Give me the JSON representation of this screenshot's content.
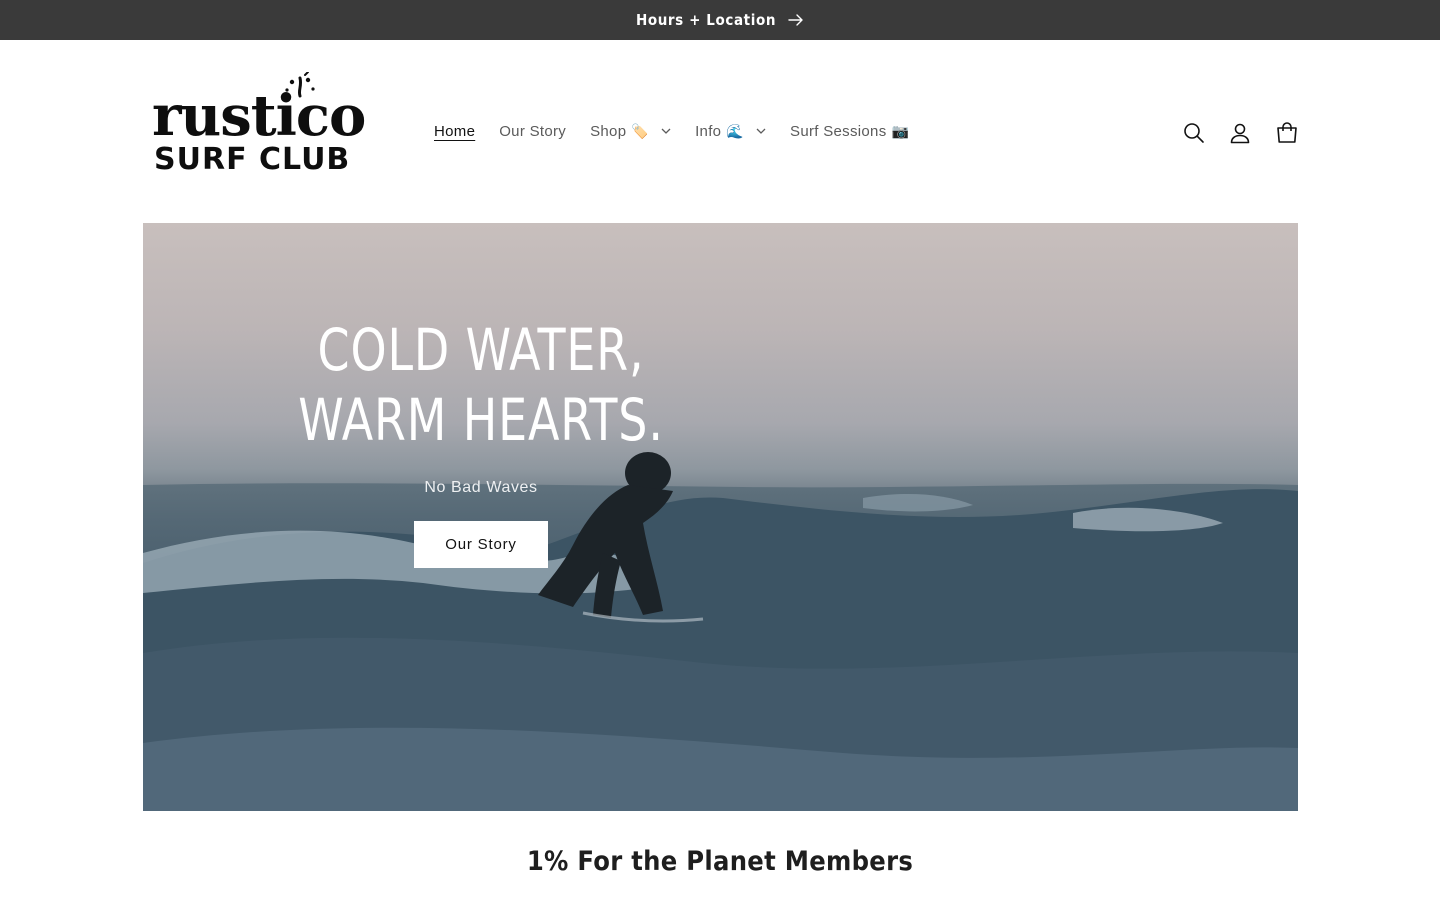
{
  "announcement": {
    "text": "Hours + Location",
    "icon": "arrow-right-icon"
  },
  "header": {
    "logo": {
      "line1": "rustico",
      "line2": "SURF CLUB"
    },
    "nav": [
      {
        "label": "Home",
        "emoji": "",
        "dropdown": false,
        "active": true
      },
      {
        "label": "Our Story",
        "emoji": "",
        "dropdown": false,
        "active": false
      },
      {
        "label": "Shop",
        "emoji": "🏷️",
        "dropdown": true,
        "active": false
      },
      {
        "label": "Info",
        "emoji": "🌊",
        "dropdown": true,
        "active": false
      },
      {
        "label": "Surf Sessions",
        "emoji": "📷",
        "dropdown": false,
        "active": false
      }
    ],
    "icons": [
      "search-icon",
      "account-icon",
      "cart-icon"
    ]
  },
  "hero": {
    "title": "COLD WATER, WARM HEARTS.",
    "subtitle": "No Bad Waves",
    "button_label": "Our Story"
  },
  "section": {
    "title": "1% For the Planet Members"
  },
  "colors": {
    "announcement_bg": "#3a3a3a",
    "text": "#121212",
    "nav_text": "#5b5b5b",
    "button_bg": "#ffffff"
  }
}
